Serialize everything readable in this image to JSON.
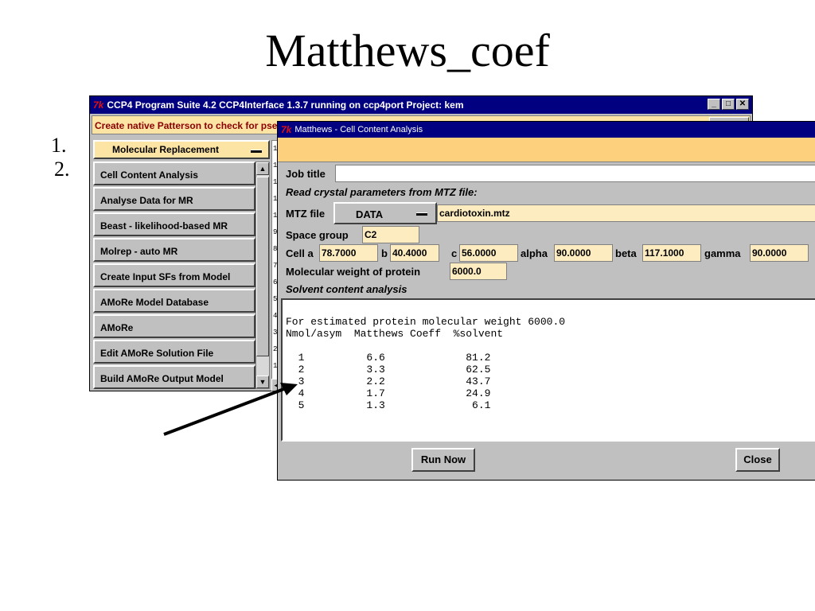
{
  "slide": {
    "title": "Matthews_coef",
    "list_numbers": [
      "1.",
      "2."
    ]
  },
  "back_window": {
    "title": "CCP4 Program Suite 4.2 CCP4Interface 1.3.7 running on ccp4port   Project: kem",
    "tk_logo": "7k",
    "window_buttons": [
      "_",
      "□",
      "✕"
    ],
    "info_text": "Create native Patterson to check for pseudo-translation",
    "module_menu": "Molecular Replacement",
    "tasks": [
      "Cell Content Analysis",
      "Analyse Data for MR",
      "Beast - likelihood-based MR",
      "Molrep - auto MR",
      "Create Input SFs from Model",
      "AMoRe Model Database",
      "AMoRe",
      "Edit AMoRe Solution File",
      "Build AMoRe Output Model"
    ],
    "job_numbers": [
      "1",
      "1",
      "1",
      "1",
      "1",
      "9",
      "8",
      "7",
      "6",
      "5",
      "4",
      "3",
      "2",
      "1"
    ]
  },
  "front_window": {
    "title": "Matthews - Cell Content Analysis",
    "tk_logo": "7k",
    "job_title_label": "Job title",
    "job_title_value": "",
    "read_params_label": "Read crystal parameters from MTZ file:",
    "mtz_file_label": "MTZ file",
    "mtz_dir": "DATA",
    "mtz_filename": "cardiotoxin.mtz",
    "space_group_label": "Space group",
    "space_group_value": "C2",
    "cell_a_label": "Cell a",
    "cell_a": "78.7000",
    "b_label": "b",
    "cell_b": "40.4000",
    "c_label": "c",
    "cell_c": "56.0000",
    "alpha_label": "alpha",
    "alpha": "90.0000",
    "beta_label": "beta",
    "beta": "117.1000",
    "gamma_label": "gamma",
    "gamma": "90.0000",
    "mw_label": "Molecular weight of protein",
    "mw_value": "6000.0",
    "solvent_label": "Solvent content analysis",
    "output_text": "For estimated protein molecular weight 6000.0\nNmol/asym  Matthews Coeff  %solvent\n\n  1          6.6             81.2\n  2          3.3             62.5\n  3          2.2             43.7\n  4          1.7             24.9\n  5          1.3              6.1",
    "run_button": "Run Now",
    "close_button": "Close"
  },
  "colors": {
    "titlebar": "#000080",
    "tk_logo": "#e01010",
    "panel_gray": "#c0c0c0",
    "info_yellow": "#fce4a4",
    "field_cream": "#fcecc0",
    "bar_orange": "#fcd07c"
  }
}
